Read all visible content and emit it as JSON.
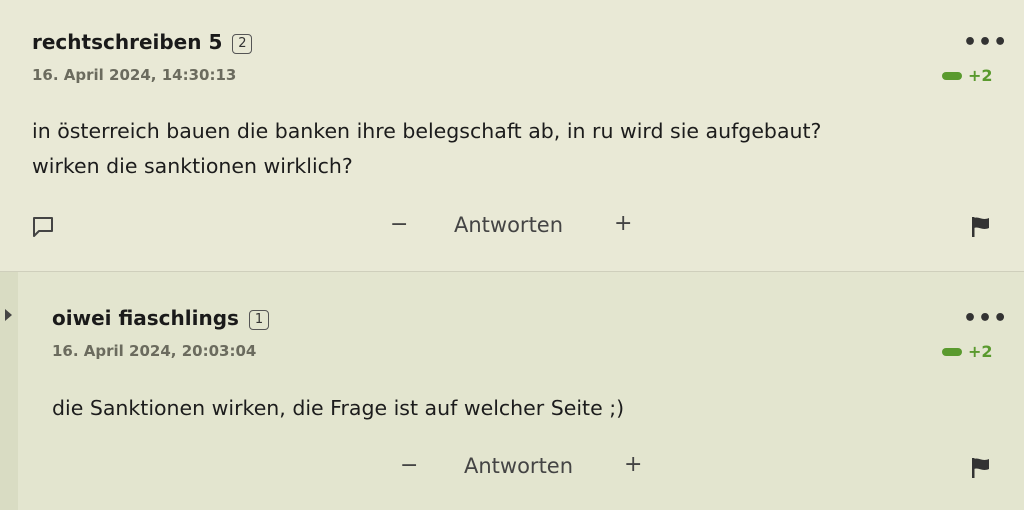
{
  "comments": [
    {
      "author": "rechtschreiben 5",
      "badge": "2",
      "timestamp": "16. April 2024, 14:30:13",
      "score": "+2",
      "text_lines": [
        "in österreich bauen die banken ihre belegschaft ab, in ru wird sie aufgebaut?",
        "wirken die sanktionen wirklich?"
      ],
      "more_label": "•••",
      "minus_label": "−",
      "reply_label": "Antworten",
      "plus_label": "+"
    },
    {
      "author": "oiwei fiaschlings",
      "badge": "1",
      "timestamp": "16. April 2024, 20:03:04",
      "score": "+2",
      "text_lines": [
        "die Sanktionen wirken, die Frage ist auf welcher Seite ;)"
      ],
      "more_label": "•••",
      "minus_label": "−",
      "reply_label": "Antworten",
      "plus_label": "+"
    }
  ],
  "icons": {
    "comment": "speech-bubble-icon",
    "flag": "flag-icon",
    "caret": "caret-right-icon"
  },
  "colors": {
    "background": "#e9e9d6",
    "reply_background": "#e3e5cf",
    "score_green": "#5a9a2e"
  }
}
